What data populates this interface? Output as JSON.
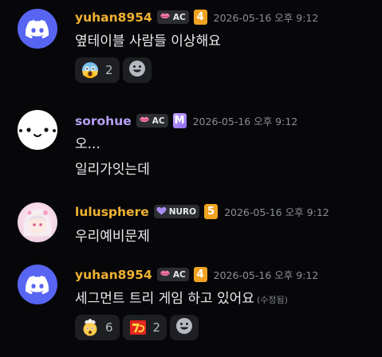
{
  "messages": [
    {
      "username": "yuhan8954",
      "user_color": "#f0b232",
      "avatar": "discord-logo-icon",
      "tag_icon": "lips-icon",
      "tag": "AC",
      "level": "4",
      "timestamp": "2026-05-16 오후 9:12",
      "lines": [
        "옆테이블 사람들 이상해요"
      ],
      "reactions": [
        {
          "emoji": "scream-emoji-icon",
          "count": "2"
        }
      ]
    },
    {
      "username": "sorohue",
      "user_color": "#b7a0f5",
      "avatar": "kaomoji-face-avatar",
      "tag_icon": "lips-icon",
      "tag": "AC",
      "level": "M",
      "timestamp": "2026-05-16 오후 9:12",
      "lines": [
        "오...",
        "일리가잇는데"
      ]
    },
    {
      "username": "lulusphere",
      "user_color": "#f0b232",
      "avatar": "anime-girl-avatar",
      "tag_icon": "purple-heart-icon",
      "tag": "NURO",
      "level": "5",
      "timestamp": "2026-05-16 오후 9:12",
      "lines": [
        "우리예비문제"
      ]
    },
    {
      "username": "yuhan8954",
      "user_color": "#f0b232",
      "avatar": "discord-logo-icon",
      "tag_icon": "lips-icon",
      "tag": "AC",
      "level": "4",
      "timestamp": "2026-05-16 오후 9:12",
      "lines": [
        "세그먼트 트리 게임 하고 있어요"
      ],
      "edited": "(수정됨)",
      "reactions": [
        {
          "emoji": "exploding-head-emoji-icon",
          "count": "6"
        },
        {
          "emoji": "sticker-emoji-icon",
          "count": "2"
        }
      ]
    }
  ]
}
